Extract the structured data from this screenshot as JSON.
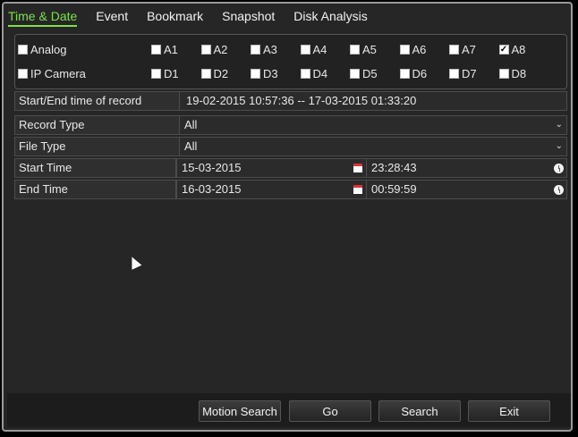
{
  "tabs": [
    "Time & Date",
    "Event",
    "Bookmark",
    "Snapshot",
    "Disk Analysis"
  ],
  "active_tab": "Time & Date",
  "analog": {
    "label": "Analog",
    "checked": false
  },
  "ip_camera": {
    "label": "IP Camera",
    "checked": false
  },
  "channels_a": [
    {
      "label": "A1",
      "checked": false
    },
    {
      "label": "A2",
      "checked": false
    },
    {
      "label": "A3",
      "checked": false
    },
    {
      "label": "A4",
      "checked": false
    },
    {
      "label": "A5",
      "checked": false
    },
    {
      "label": "A6",
      "checked": false
    },
    {
      "label": "A7",
      "checked": false
    },
    {
      "label": "A8",
      "checked": true
    }
  ],
  "channels_d": [
    {
      "label": "D1",
      "checked": false
    },
    {
      "label": "D2",
      "checked": false
    },
    {
      "label": "D3",
      "checked": false
    },
    {
      "label": "D4",
      "checked": false
    },
    {
      "label": "D5",
      "checked": false
    },
    {
      "label": "D6",
      "checked": false
    },
    {
      "label": "D7",
      "checked": false
    },
    {
      "label": "D8",
      "checked": false
    }
  ],
  "record_range": {
    "label": "Start/End time of record",
    "value": "19-02-2015 10:57:36 -- 17-03-2015 01:33:20"
  },
  "record_type": {
    "label": "Record Type",
    "value": "All"
  },
  "file_type": {
    "label": "File Type",
    "value": "All"
  },
  "start_time": {
    "label": "Start Time",
    "date": "15-03-2015",
    "time": "23:28:43"
  },
  "end_time": {
    "label": "End Time",
    "date": "16-03-2015",
    "time": "00:59:59"
  },
  "buttons": {
    "motion_search": "Motion Search",
    "go": "Go",
    "search": "Search",
    "exit": "Exit"
  }
}
